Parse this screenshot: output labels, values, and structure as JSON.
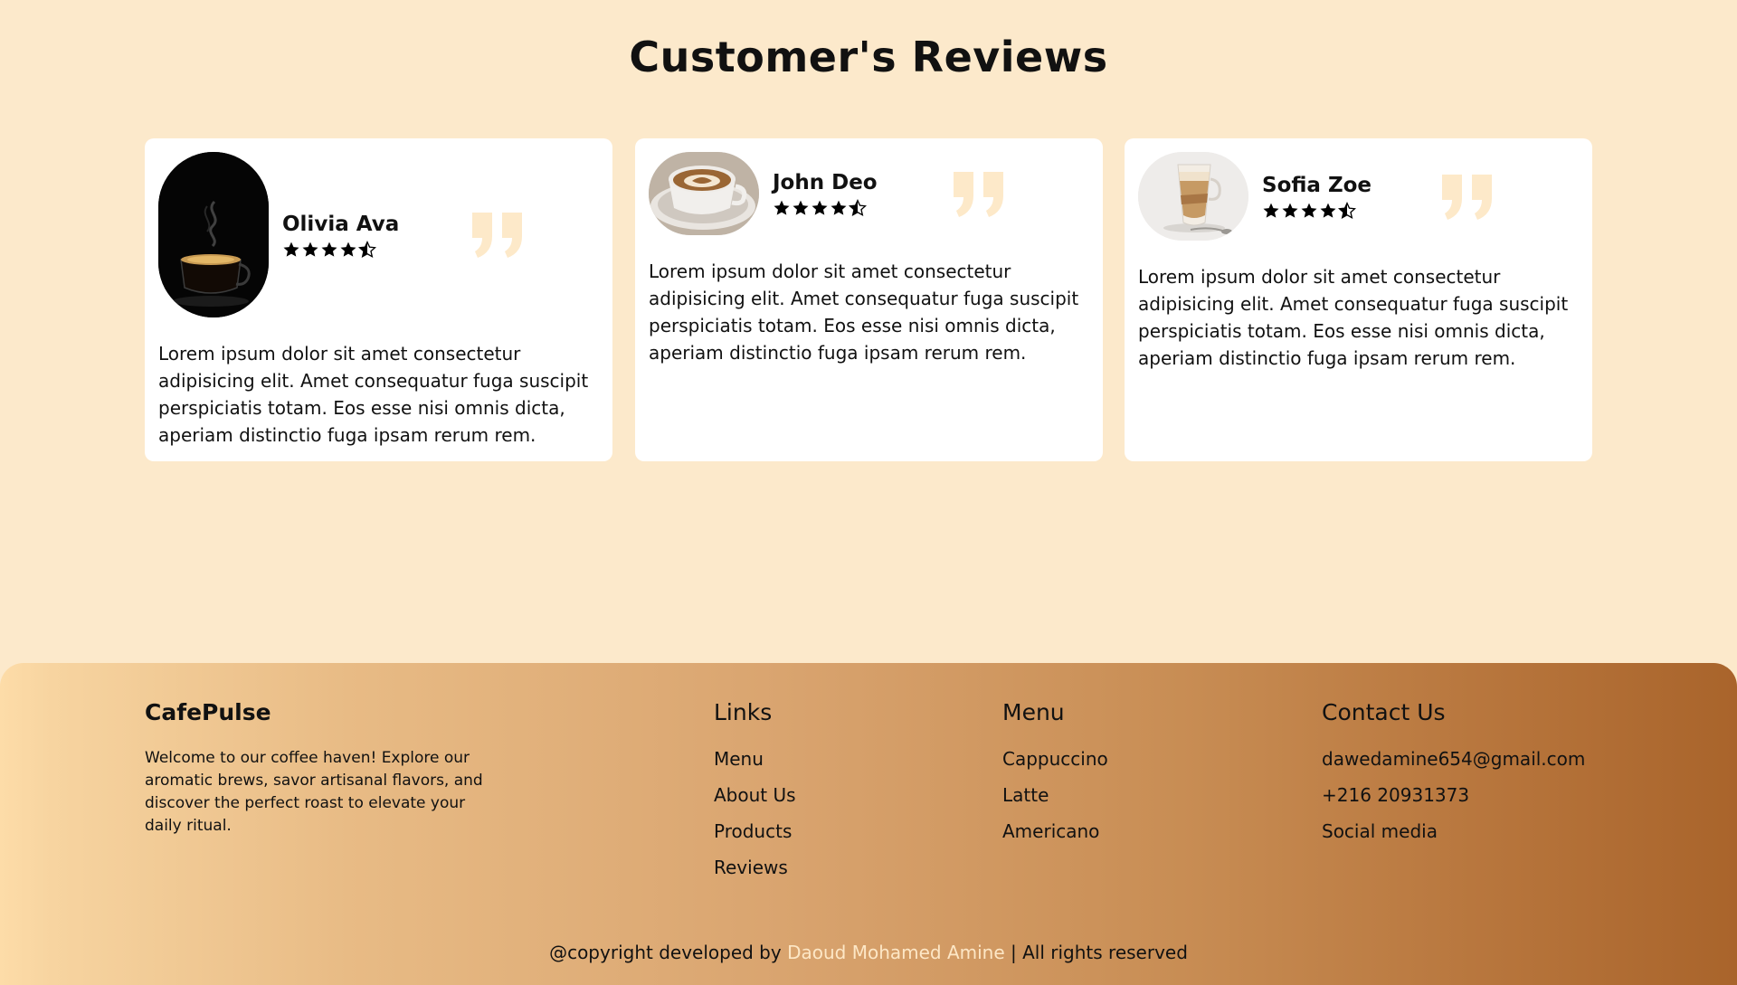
{
  "reviews": {
    "title": "Customer's Reviews",
    "cards": [
      {
        "name": "Olivia Ava",
        "rating": 4.5,
        "avatar": "espresso-cup-photo",
        "text": "Lorem ipsum dolor sit amet consectetur adipisicing elit. Amet consequatur fuga suscipit perspiciatis totam. Eos esse nisi omnis dicta, aperiam distinctio fuga ipsam rerum rem."
      },
      {
        "name": "John Deo",
        "rating": 4.5,
        "avatar": "latte-art-cup-photo",
        "text": "Lorem ipsum dolor sit amet consectetur adipisicing elit. Amet consequatur fuga suscipit perspiciatis totam. Eos esse nisi omnis dicta, aperiam distinctio fuga ipsam rerum rem."
      },
      {
        "name": "Sofia Zoe",
        "rating": 4.5,
        "avatar": "latte-glass-photo",
        "text": "Lorem ipsum dolor sit amet consectetur adipisicing elit. Amet consequatur fuga suscipit perspiciatis totam. Eos esse nisi omnis dicta, aperiam distinctio fuga ipsam rerum rem."
      }
    ]
  },
  "footer": {
    "brand": "CafePulse",
    "description": "Welcome to our coffee haven! Explore our aromatic brews, savor artisanal flavors, and discover the perfect roast to elevate your daily ritual.",
    "links": {
      "heading": "Links",
      "items": [
        "Menu",
        "About Us",
        "Products",
        "Reviews"
      ]
    },
    "menu": {
      "heading": "Menu",
      "items": [
        "Cappuccino",
        "Latte",
        "Americano"
      ]
    },
    "contact": {
      "heading": "Contact Us",
      "items": [
        "dawedamine654@gmail.com",
        "+216 20931373",
        "Social media"
      ]
    },
    "copyright": {
      "prefix": "@copyright developed by ",
      "author": "Daoud Mohamed Amine",
      "suffix": " | All rights reserved"
    }
  },
  "colors": {
    "page_bg": "#fce9cb",
    "card_bg": "#ffffff",
    "quote_icon": "#fde9c9",
    "author_link": "#fde7c6",
    "footer_gradient_start": "#fddca8",
    "footer_gradient_end": "#a9642b"
  },
  "icons": {
    "star": "star-icon",
    "half_star": "half-star-icon",
    "quote": "quote-icon"
  }
}
